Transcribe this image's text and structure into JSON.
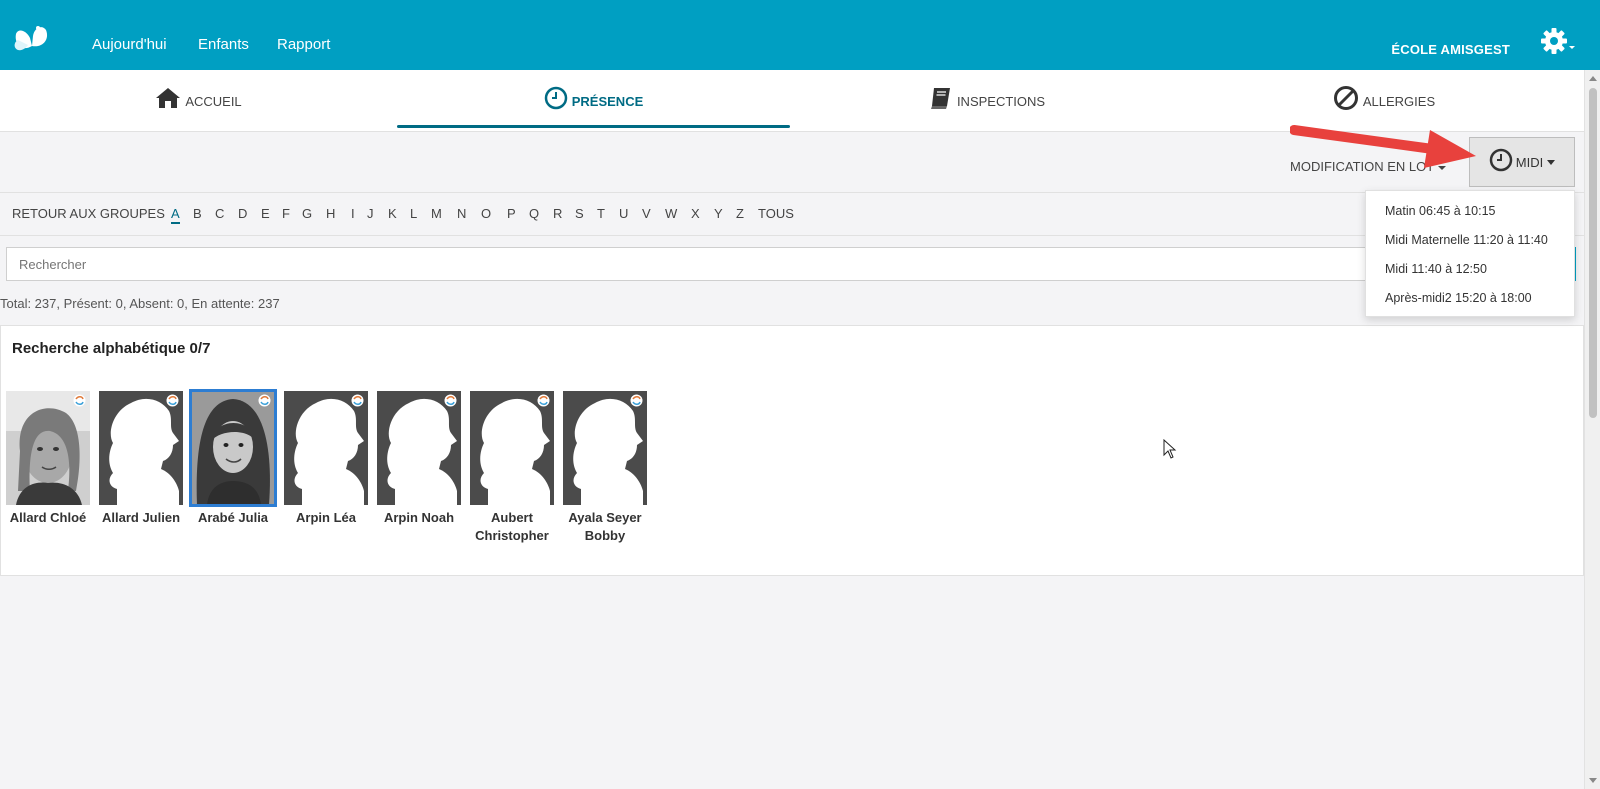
{
  "topnav": {
    "logo_icon": "butterfly-logo-icon",
    "links": [
      "Aujourd'hui",
      "Enfants",
      "Rapport"
    ],
    "school": "ÉCOLE AMISGEST",
    "settings_icon": "gear-icon"
  },
  "tabs": [
    {
      "label": "ACCUEIL",
      "icon": "home-icon"
    },
    {
      "label": "PRÉSENCE",
      "icon": "clock-icon",
      "active": true
    },
    {
      "label": "INSPECTIONS",
      "icon": "book-icon"
    },
    {
      "label": "ALLERGIES",
      "icon": "ban-icon"
    }
  ],
  "toolbar": {
    "batch_label": "MODIFICATION EN LOT",
    "period_label": "MIDI"
  },
  "period_menu": [
    "Matin 06:45 à 10:15",
    "Midi Maternelle 11:20 à 11:40",
    "Midi 11:40 à 12:50",
    "Après-midi2 15:20 à 18:00"
  ],
  "alphabet": {
    "back_label": "RETOUR AUX GROUPES",
    "letters": [
      "A",
      "B",
      "C",
      "D",
      "E",
      "F",
      "G",
      "H",
      "I",
      "J",
      "K",
      "L",
      "M",
      "N",
      "O",
      "P",
      "Q",
      "R",
      "S",
      "T",
      "U",
      "V",
      "W",
      "X",
      "Y",
      "Z",
      "TOUS"
    ],
    "active": "A"
  },
  "search": {
    "placeholder": "Rechercher"
  },
  "totals": "Total: 237, Présent: 0, Absent: 0, En attente: 237",
  "panel": {
    "title": "Recherche alphabétique 0/7",
    "children": [
      {
        "name": "Allard Chloé",
        "photo": "photo"
      },
      {
        "name": "Allard Julien",
        "photo": "silhouette"
      },
      {
        "name": "Arabé Julia",
        "photo": "photo",
        "selected": true
      },
      {
        "name": "Arpin Léa",
        "photo": "silhouette"
      },
      {
        "name": "Arpin Noah",
        "photo": "silhouette"
      },
      {
        "name": "Aubert Christopher",
        "photo": "silhouette"
      },
      {
        "name": "Ayala Seyer Bobby",
        "photo": "silhouette"
      }
    ]
  },
  "colors": {
    "brand": "#009fc2",
    "active_tab": "#006b84",
    "annotation_arrow": "#e8413d"
  }
}
